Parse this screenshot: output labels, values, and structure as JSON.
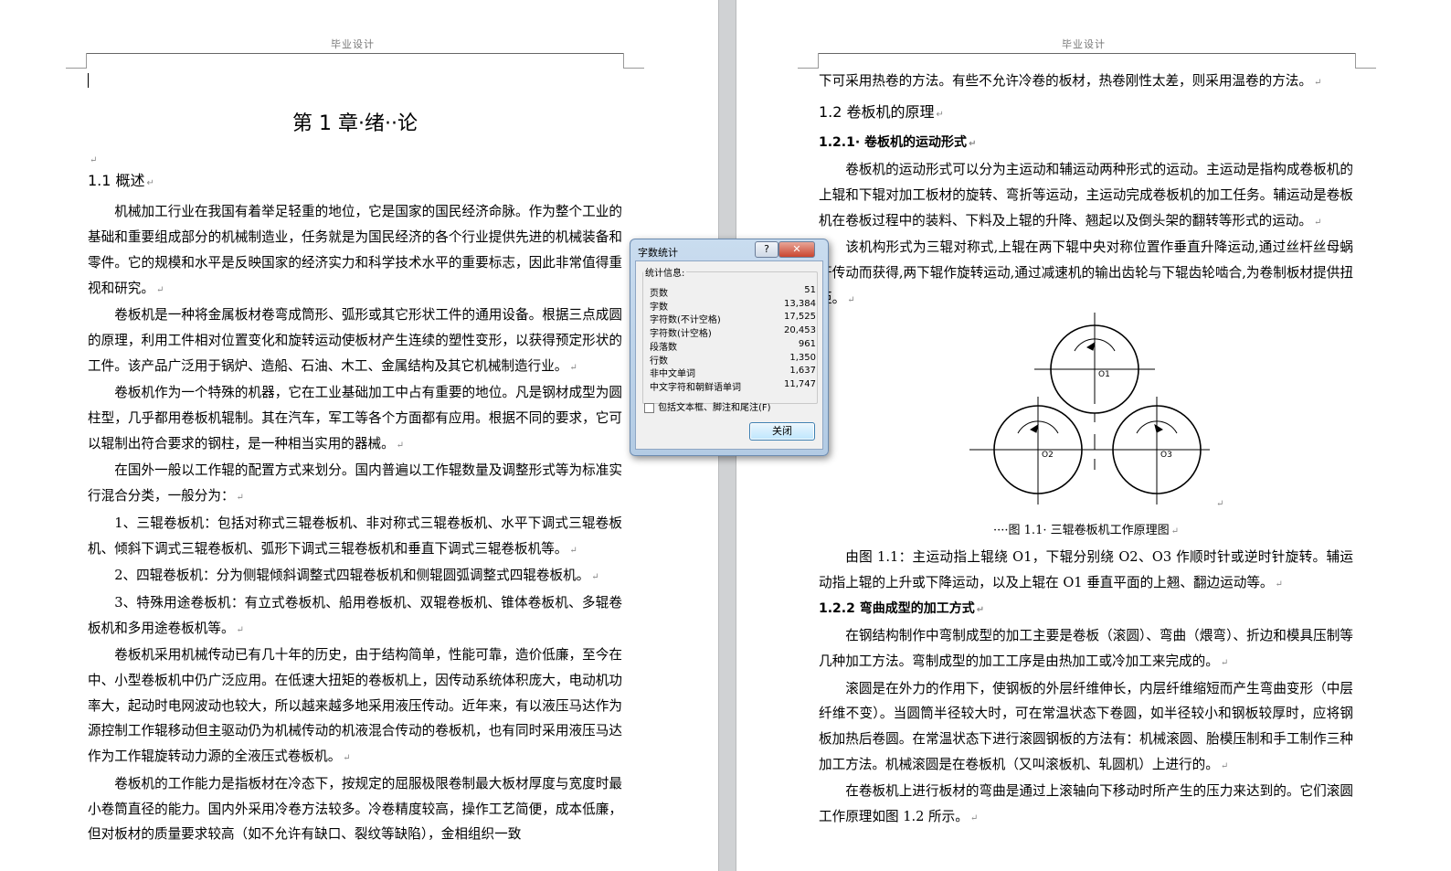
{
  "left_page": {
    "header": "毕业设计",
    "chapter_title": "第 1 章·绪··论",
    "sections": [
      {
        "type": "h2",
        "text": "1.1 概述"
      },
      {
        "type": "p",
        "text": "机械加工行业在我国有着举足轻重的地位，它是国家的国民经济命脉。作为整个工业的基础和重要组成部分的机械制造业，任务就是为国民经济的各个行业提供先进的机械装备和零件。它的规模和水平是反映国家的经济实力和科学技术水平的重要标志，因此非常值得重视和研究。"
      },
      {
        "type": "p",
        "text": "卷板机是一种将金属板材卷弯成筒形、弧形或其它形状工件的通用设备。根据三点成圆的原理，利用工件相对位置变化和旋转运动使板材产生连续的塑性变形，以获得预定形状的工件。该产品广泛用于锅炉、造船、石油、木工、金属结构及其它机械制造行业。"
      },
      {
        "type": "p",
        "text": "卷板机作为一个特殊的机器，它在工业基础加工中占有重要的地位。凡是钢材成型为圆柱型，几乎都用卷板机辊制。其在汽车，军工等各个方面都有应用。根据不同的要求，它可以辊制出符合要求的钢柱，是一种相当实用的器械。"
      },
      {
        "type": "p",
        "text": "在国外一般以工作辊的配置方式来划分。国内普遍以工作辊数量及调整形式等为标准实行混合分类，一般分为："
      },
      {
        "type": "p",
        "text": "1、三辊卷板机：包括对称式三辊卷板机、非对称式三辊卷板机、水平下调式三辊卷板机、倾斜下调式三辊卷板机、弧形下调式三辊卷板机和垂直下调式三辊卷板机等。"
      },
      {
        "type": "p",
        "text": "2、四辊卷板机：分为侧辊倾斜调整式四辊卷板机和侧辊圆弧调整式四辊卷板机。"
      },
      {
        "type": "p",
        "text": "3、特殊用途卷板机：有立式卷板机、船用卷板机、双辊卷板机、锥体卷板机、多辊卷板机和多用途卷板机等。"
      },
      {
        "type": "p",
        "text": "卷板机采用机械传动已有几十年的历史，由于结构简单，性能可靠，造价低廉，至今在中、小型卷板机中仍广泛应用。在低速大扭矩的卷板机上，因传动系统体积庞大，电动机功率大，起动时电网波动也较大，所以越来越多地采用液压传动。近年来，有以液压马达作为源控制工作辊移动但主驱动仍为机械传动的机液混合传动的卷板机，也有同时采用液压马达作为工作辊旋转动力源的全液压式卷板机。"
      },
      {
        "type": "p",
        "text": "卷板机的工作能力是指板材在冷态下，按规定的屈服极限卷制最大板材厚度与宽度时最小卷筒直径的能力。国内外采用冷卷方法较多。冷卷精度较高，操作工艺简便，成本低廉，但对板材的质量要求较高（如不允许有缺口、裂纹等缺陷），金相组织一致"
      }
    ]
  },
  "right_page": {
    "header": "毕业设计",
    "sections": [
      {
        "type": "p0",
        "text": "下可采用热卷的方法。有些不允许冷卷的板材，热卷刚性太差，则采用温卷的方法。"
      },
      {
        "type": "h2",
        "text": "1.2 卷板机的原理"
      },
      {
        "type": "h3",
        "text": "1.2.1· 卷板机的运动形式"
      },
      {
        "type": "p",
        "text": "卷板机的运动形式可以分为主运动和辅运动两种形式的运动。主运动是指构成卷板机的上辊和下辊对加工板材的旋转、弯折等运动，主运动完成卷板机的加工任务。辅运动是卷板机在卷板过程中的装料、下料及上辊的升降、翘起以及倒头架的翻转等形式的运动。"
      },
      {
        "type": "p",
        "text": "该机构形式为三辊对称式,上辊在两下辊中央对称位置作垂直升降运动,通过丝杆丝母蜗杆传动而获得,两下辊作旋转运动,通过减速机的输出齿轮与下辊齿轮啮合,为卷制板材提供扭矩。"
      },
      {
        "type": "figure"
      },
      {
        "type": "caption",
        "text": "····图 1.1· 三辊卷板机工作原理图"
      },
      {
        "type": "p",
        "text": "由图 1.1：主运动指上辊绕 O1，下辊分别绕 O2、O3 作顺时针或逆时针旋转。辅运动指上辊的上升或下降运动，以及上辊在 O1 垂直平面的上翘、翻边运动等。"
      },
      {
        "type": "h3",
        "text": "1.2.2 弯曲成型的加工方式"
      },
      {
        "type": "p",
        "text": "在钢结构制作中弯制成型的加工主要是卷板（滚圆）、弯曲（煨弯）、折边和模具压制等几种加工方法。弯制成型的加工工序是由热加工或冷加工来完成的。"
      },
      {
        "type": "p",
        "text": "滚圆是在外力的作用下，使钢板的外层纤维伸长，内层纤维缩短而产生弯曲变形（中层纤维不变）。当圆筒半径较大时，可在常温状态下卷圆，如半径较小和钢板较厚时，应将钢板加热后卷圆。在常温状态下进行滚圆钢板的方法有：机械滚圆、胎模压制和手工制作三种加工方法。机械滚圆是在卷板机（又叫滚板机、轧圆机）上进行的。"
      },
      {
        "type": "p",
        "text": "在卷板机上进行板材的弯曲是通过上滚轴向下移动时所产生的压力来达到的。它们滚圆工作原理如图 1.2 所示。"
      }
    ],
    "figure_labels": {
      "o1": "O1",
      "o2": "O2",
      "o3": "O3"
    }
  },
  "dialog": {
    "title": "字数统计",
    "help_label": "?",
    "close_x": "✕",
    "group_label": "统计信息:",
    "stats": [
      {
        "k": "页数",
        "v": "51"
      },
      {
        "k": "字数",
        "v": "13,384"
      },
      {
        "k": "字符数(不计空格)",
        "v": "17,525"
      },
      {
        "k": "字符数(计空格)",
        "v": "20,453"
      },
      {
        "k": "段落数",
        "v": "961"
      },
      {
        "k": "行数",
        "v": "1,350"
      },
      {
        "k": "非中文单词",
        "v": "1,637"
      },
      {
        "k": "中文字符和朝鲜语单词",
        "v": "11,747"
      }
    ],
    "checkbox_label": "包括文本框、脚注和尾注(F)",
    "close_button": "关闭"
  }
}
